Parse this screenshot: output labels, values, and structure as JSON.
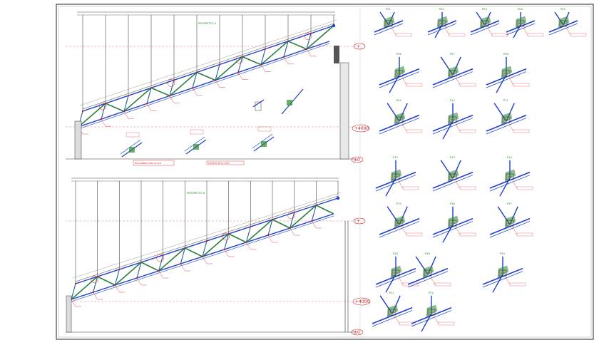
{
  "drawing": {
    "elevation_1": {
      "label": "PROSPETTO A",
      "level_top": "+",
      "level_mid": "+4000",
      "level_base": "±0"
    },
    "elevation_2": {
      "label": "PROSPETTO B",
      "level_top": "+",
      "level_mid": "+4000",
      "level_base": "±0"
    },
    "details": {
      "top": [
        "P01",
        "P02",
        "P03",
        "P04",
        "P05"
      ],
      "row2": [
        "P06",
        "P07",
        "P08"
      ],
      "row3": [
        "P09",
        "P10",
        "P11"
      ],
      "row4": [
        "P12",
        "P13",
        "P14"
      ],
      "row5": [
        "P15",
        "P16",
        "P17"
      ],
      "row6": [
        "P18",
        "P19",
        "P20"
      ],
      "row7": [
        "P21",
        "P22"
      ]
    },
    "notes": {
      "note1": "BULLONERIA M16 CL.8.8",
      "note2": "PIASTRA SP.10 S275",
      "note3": "SALDATURA A CORDONE"
    }
  }
}
